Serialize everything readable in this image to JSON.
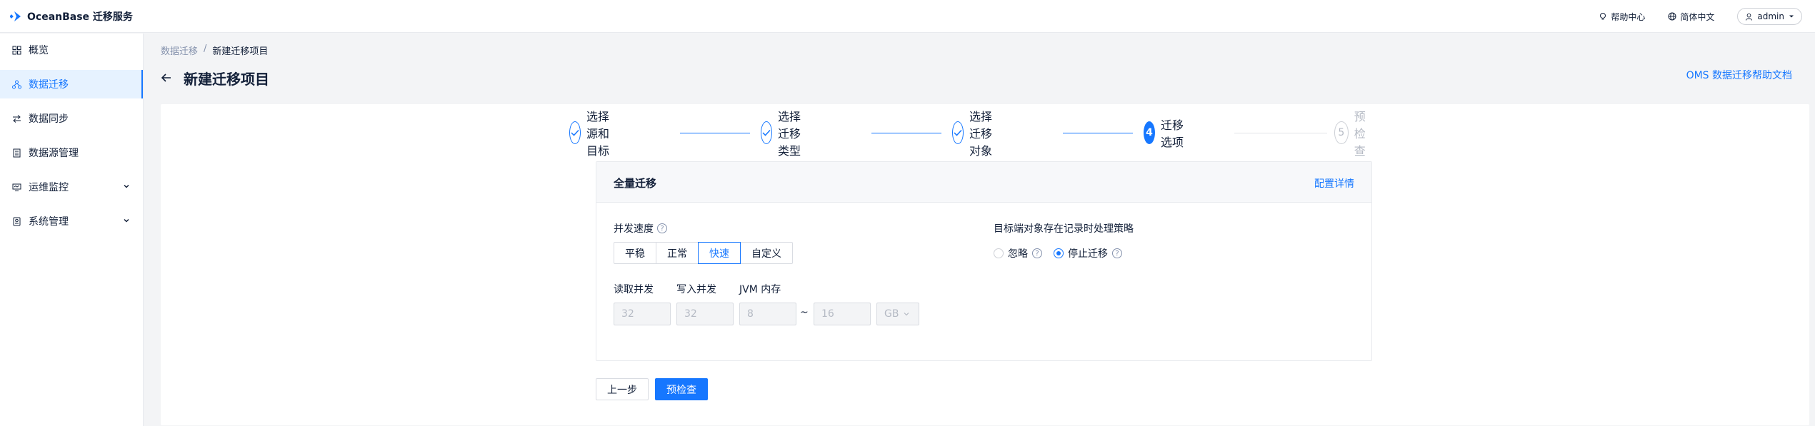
{
  "header": {
    "brand": "OceanBase 迁移服务",
    "help_center": "帮助中心",
    "language": "简体中文",
    "user": "admin"
  },
  "sidebar": {
    "items": [
      {
        "label": "概览",
        "icon": "grid-icon"
      },
      {
        "label": "数据迁移",
        "icon": "migration-icon"
      },
      {
        "label": "数据同步",
        "icon": "sync-icon"
      },
      {
        "label": "数据源管理",
        "icon": "datasource-icon"
      },
      {
        "label": "运维监控",
        "icon": "monitor-icon"
      },
      {
        "label": "系统管理",
        "icon": "system-icon"
      }
    ]
  },
  "breadcrumb": {
    "parent": "数据迁移",
    "sep": "/",
    "current": "新建迁移项目"
  },
  "page": {
    "title": "新建迁移项目",
    "help_doc": "OMS 数据迁移帮助文档"
  },
  "steps": [
    {
      "label": "选择源和目标",
      "status": "done",
      "num": ""
    },
    {
      "label": "选择迁移类型",
      "status": "done",
      "num": ""
    },
    {
      "label": "选择迁移对象",
      "status": "done",
      "num": ""
    },
    {
      "label": "迁移选项",
      "status": "current",
      "num": "4"
    },
    {
      "label": "预检查",
      "status": "wait",
      "num": "5"
    }
  ],
  "panel": {
    "title": "全量迁移",
    "config_link": "配置详情",
    "speed_label": "并发速度",
    "speed_options": [
      "平稳",
      "正常",
      "快速",
      "自定义"
    ],
    "speed_selected": "快速",
    "strategy_label": "目标端对象存在记录时处理策略",
    "strategy_options": [
      "忽略",
      "停止迁移"
    ],
    "strategy_selected": "停止迁移",
    "read_label": "读取并发",
    "write_label": "写入并发",
    "jvm_label": "JVM 内存",
    "read_value": "32",
    "write_value": "32",
    "jvm_min": "8",
    "jvm_sep": "~",
    "jvm_max": "16",
    "jvm_unit": "GB"
  },
  "footer": {
    "prev": "上一步",
    "precheck": "预检查"
  },
  "colors": {
    "primary": "#1677ff",
    "active_bg": "#e6f2ff"
  }
}
